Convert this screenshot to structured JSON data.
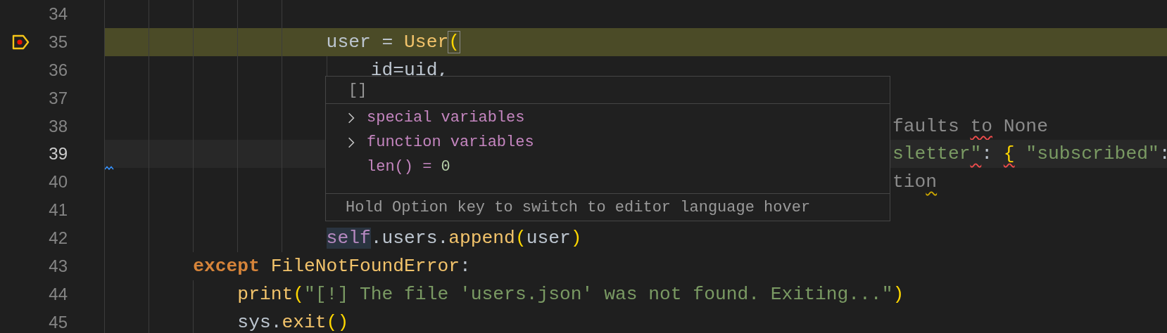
{
  "editor": {
    "lines": [
      {
        "children": [
          {
            "children": [
              {
                "children": [
                  {
                    "children": [
                      {
                        "children": [
                          {
                            "number": "34",
                            "breakpoint": false,
                            "paused": false,
                            "current": false
                          },
                          {
                            "number": "35",
                            "kind": "code",
                            "breakpoint": true,
                            "paused": true,
                            "current": false,
                            "tokens": [
                              {
                                "text": "user = ",
                                "kind": "plain"
                              },
                              {
                                "text": "User",
                                "kind": "class"
                              },
                              {
                                "text": "(",
                                "kind": "bracket",
                                "boxed": true
                              }
                            ]
                          },
                          {
                            "children": [
                              {
                                "number": "36",
                                "kind": "code",
                                "breakpoint": false,
                                "paused": false,
                                "current": false,
                                "tokens": [
                                  {
                                    "text": "id=uid,",
                                    "kind": "plain"
                                  }
                                ]
                              }
                            ]
                          },
                          {
                            "number": "37",
                            "breakpoint": false,
                            "paused": false,
                            "current": false
                          },
                          {
                            "number": "38",
                            "kind": "covered",
                            "breakpoint": false,
                            "paused": false,
                            "current": false,
                            "tokens": [
                              {
                                "text": "faults ",
                                "kind": "comment"
                              },
                              {
                                "text": "to",
                                "kind": "comment",
                                "error": true
                              },
                              {
                                "text": " None",
                                "kind": "comment"
                              }
                            ]
                          },
                          {
                            "number": "39",
                            "kind": "covered",
                            "breakpoint": false,
                            "paused": false,
                            "current": true,
                            "hint_marker": true,
                            "tokens": [
                              {
                                "text": "sletter",
                                "kind": "string"
                              },
                              {
                                "text": "\"",
                                "kind": "string",
                                "error": true
                              },
                              {
                                "text": ": ",
                                "kind": "plain"
                              },
                              {
                                "text": "{",
                                "kind": "bracket",
                                "error": true
                              },
                              {
                                "text": " \"subscribed\"",
                                "kind": "string"
                              },
                              {
                                "text": ":",
                                "kind": "plain"
                              }
                            ]
                          },
                          {
                            "number": "40",
                            "kind": "covered",
                            "breakpoint": false,
                            "paused": false,
                            "current": false,
                            "tokens": [
                              {
                                "text": "tio",
                                "kind": "comment"
                              },
                              {
                                "text": "n",
                                "kind": "comment",
                                "warning": true
                              }
                            ]
                          },
                          {
                            "number": "41",
                            "breakpoint": false,
                            "paused": false,
                            "current": false
                          },
                          {
                            "number": "42",
                            "kind": "code",
                            "breakpoint": false,
                            "paused": false,
                            "current": false,
                            "tokens": [
                              {
                                "text": "self",
                                "kind": "self",
                                "highlighted": true
                              },
                              {
                                "text": ".users.",
                                "kind": "plain"
                              },
                              {
                                "text": "append",
                                "kind": "function"
                              },
                              {
                                "text": "(",
                                "kind": "bracket"
                              },
                              {
                                "text": "user",
                                "kind": "plain"
                              },
                              {
                                "text": ")",
                                "kind": "bracket"
                              }
                            ]
                          }
                        ]
                      }
                    ]
                  }
                ]
              },
              {
                "number": "43",
                "kind": "code",
                "breakpoint": false,
                "paused": false,
                "current": false,
                "tokens": [
                  {
                    "text": "except ",
                    "kind": "keyword"
                  },
                  {
                    "text": "FileNotFoundError",
                    "kind": "class"
                  },
                  {
                    "text": ":",
                    "kind": "plain"
                  }
                ],
                "children": [
                  {
                    "number": "44",
                    "kind": "code",
                    "breakpoint": false,
                    "paused": false,
                    "current": false,
                    "tokens": [
                      {
                        "text": "print",
                        "kind": "function"
                      },
                      {
                        "text": "(",
                        "kind": "bracket"
                      },
                      {
                        "text": "\"[!] The file 'users.json' was not found. Exiting...\"",
                        "kind": "string"
                      },
                      {
                        "text": ")",
                        "kind": "bracket"
                      }
                    ]
                  },
                  {
                    "number": "45",
                    "kind": "code",
                    "breakpoint": false,
                    "paused": false,
                    "current": false,
                    "tokens": [
                      {
                        "text": "sys.",
                        "kind": "plain"
                      },
                      {
                        "text": "exit",
                        "kind": "function"
                      },
                      {
                        "text": "()",
                        "kind": "bracket"
                      }
                    ]
                  }
                ]
              }
            ]
          }
        ]
      }
    ]
  },
  "hover": {
    "title": "[]",
    "items": [
      {
        "name": "special variables",
        "expandable": true
      },
      {
        "name": "function variables",
        "expandable": true
      },
      {
        "name": "len() =",
        "value": "0",
        "expandable": false
      }
    ],
    "footer": "Hold Option key to switch to editor language hover"
  }
}
